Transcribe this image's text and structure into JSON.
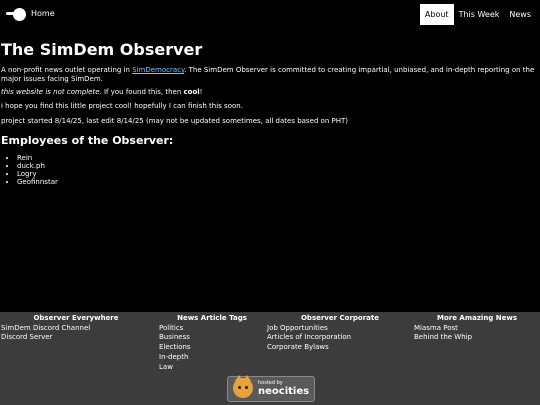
{
  "nav": {
    "home": "Home",
    "tabs": [
      {
        "label": "About",
        "active": true
      },
      {
        "label": "This Week",
        "active": false
      },
      {
        "label": "News",
        "active": false
      }
    ]
  },
  "main": {
    "title": "The SimDem Observer",
    "intro_before_link": "A non-profit news outlet operating in ",
    "intro_link": "SimDemocracy",
    "intro_after_link": ". The SimDem Observer is committed to creating impartial, unbiased, and in-depth reporting on the major issues facing SimDem.",
    "incomplete_em": "this website is not complete",
    "incomplete_middle": ". If you found this, then ",
    "incomplete_strong": "cool",
    "incomplete_end": "!",
    "hope": "i hope you find this little project cool! hopefully I can finish this soon.",
    "dates": "project started 8/14/25, last edit 8/14/25 (may not be updated sometimes, all dates based on PHT)",
    "employees_heading": "Employees of the Observer:",
    "employees": [
      "Rein",
      "duck.ph",
      "Logry",
      "Geofinnstar"
    ]
  },
  "footer": {
    "columns": [
      {
        "heading": "Observer Everywhere",
        "links": [
          "SimDem Discord Channel",
          "Discord Server"
        ]
      },
      {
        "heading": "News Article Tags",
        "links": [
          "Politics",
          "Business",
          "Elections",
          "In-depth",
          "Law"
        ]
      },
      {
        "heading": "Observer Corporate",
        "links": [
          "Job Opportunities",
          "Articles of Incorporation",
          "Corporate Bylaws"
        ]
      },
      {
        "heading": "More Amazing News",
        "links": [
          "Miasma Post",
          "Behind the Whip"
        ]
      }
    ],
    "badge": {
      "small": "hosted by",
      "large": "neocities"
    }
  },
  "colors": {
    "background": "#000000",
    "footer": "#3c3c3c",
    "link": "#66ccff",
    "badge_cat": "#e7a23a"
  }
}
